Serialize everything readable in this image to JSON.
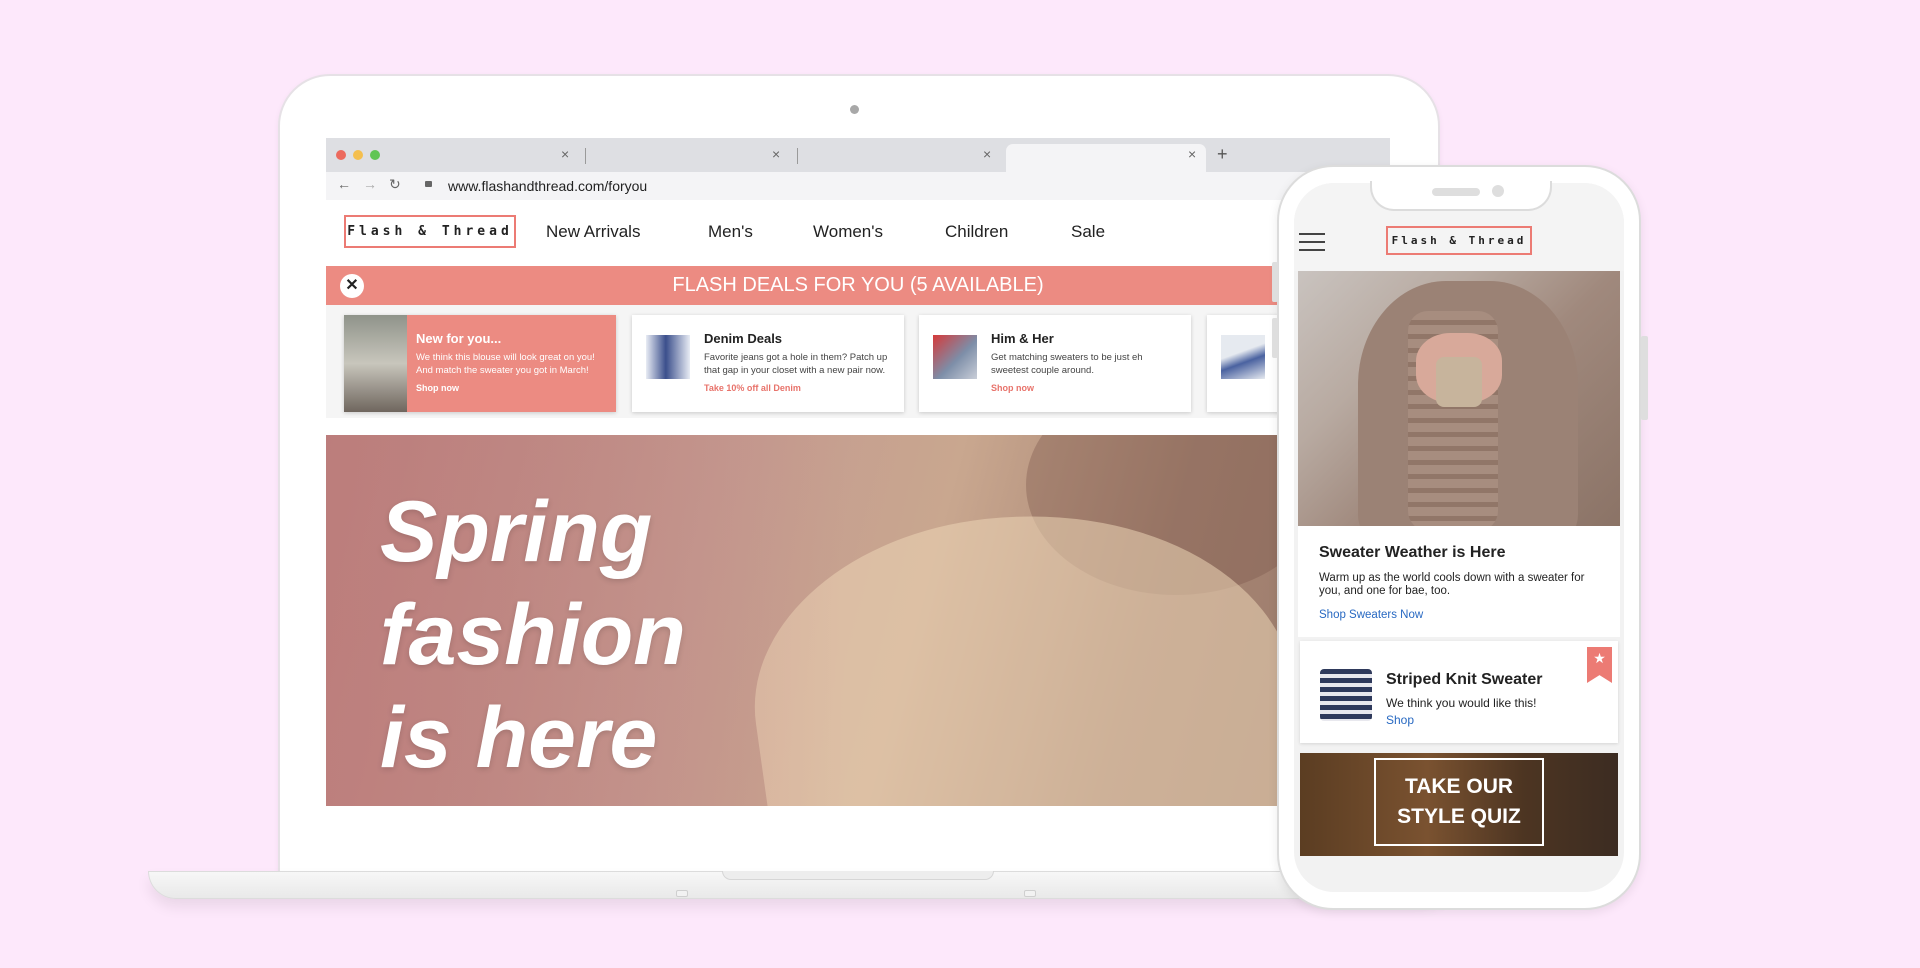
{
  "laptop": {
    "browser": {
      "tabs": [
        "",
        "",
        "",
        ""
      ],
      "url": "www.flashandthread.com/foryou",
      "icons": [
        "back-arrow-icon",
        "forward-arrow-icon",
        "reload-icon",
        "lock-icon",
        "tab-close-icon",
        "new-tab-plus-icon"
      ]
    },
    "site": {
      "logo": "Flash & Thread",
      "nav": [
        "New Arrivals",
        "Men's",
        "Women's",
        "Children",
        "Sale"
      ],
      "flash_banner": "FLASH DEALS FOR YOU (5 AVAILABLE)",
      "close_symbol": "✕",
      "cards": [
        {
          "title": "New for you...",
          "body": "We think this blouse will look great on you! And match the sweater you got in March!",
          "link": "Shop now"
        },
        {
          "title": "Denim Deals",
          "body": "Favorite jeans got a hole in them? Patch up that gap in your closet with a new pair now.",
          "link": "Take 10% off all Denim"
        },
        {
          "title": "Him & Her",
          "body": "Get matching sweaters to be just eh sweetest couple around.",
          "link": "Shop now"
        }
      ],
      "hero": {
        "line1": "Spring",
        "line2": "fashion",
        "line3": "is here"
      }
    }
  },
  "phone": {
    "logo": "Flash & Thread",
    "feature": {
      "title": "Sweater Weather is Here",
      "body": "Warm up as the world cools down with a sweater for you, and one for bae, too.",
      "link": "Shop Sweaters Now"
    },
    "recommendation": {
      "title": "Striped Knit Sweater",
      "body": "We think you would like this!",
      "link": "Shop",
      "badge_symbol": "★"
    },
    "quiz": {
      "line1": "TAKE OUR",
      "line2": "STYLE QUIZ"
    }
  },
  "colors": {
    "background": "#fde8fb",
    "brand_coral": "#ec8b82",
    "link_blue": "#2869c2"
  }
}
